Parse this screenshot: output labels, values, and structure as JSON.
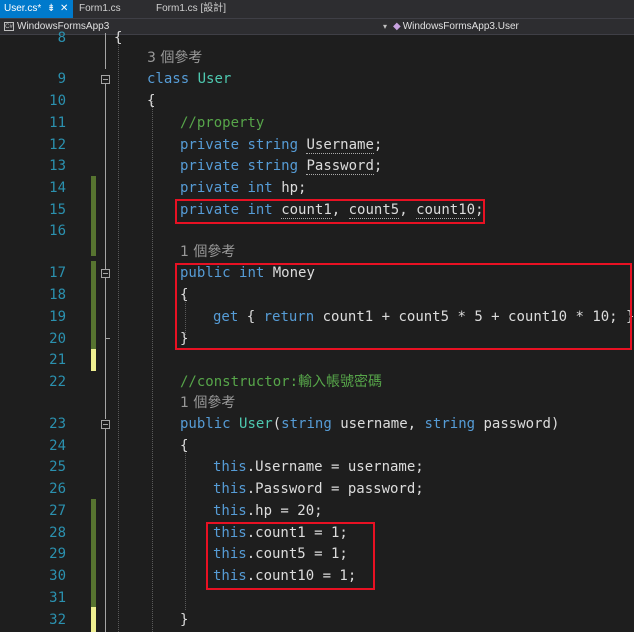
{
  "tabs": [
    {
      "name": "User.cs*",
      "pin": "⇟",
      "close": "✕"
    },
    {
      "name": "Form1.cs"
    },
    {
      "name": "Form1.cs [設計]"
    }
  ],
  "navbar": {
    "project_icon": "C#",
    "project": "WindowsFormsApp3",
    "member": "WindowsFormsApp3.User"
  },
  "editor": {
    "line_numbers": [
      "8",
      "9",
      "10",
      "11",
      "12",
      "13",
      "14",
      "15",
      "16",
      "17",
      "18",
      "19",
      "20",
      "21",
      "22",
      "23",
      "24",
      "25",
      "26",
      "27",
      "28",
      "29",
      "30",
      "31",
      "32"
    ],
    "lens_refs": {
      "class": "3 個參考",
      "money": "1 個參考",
      "ctor": "1 個參考"
    },
    "code": {
      "open_brace_8": "{",
      "kw_class": "class",
      "type_user": "User",
      "brace_open": "{",
      "comment_property": "//property",
      "kw_private": "private",
      "kw_string": "string",
      "kw_int": "int",
      "username_field": "Username",
      "password_field": "Password",
      "hp_field": "hp",
      "count1": "count1",
      "count5": "count5",
      "count10": "count10",
      "kw_public": "public",
      "money": "Money",
      "kw_get": "get",
      "kw_return": "return",
      "get_open": " { ",
      "get_expr": " count1 + count5 * 5 + count10 * 10; }",
      "brace_close": "}",
      "comment_ctor": "//constructor:輸入帳號密碼",
      "ctor_type": "User",
      "param_username": "username",
      "param_password": "password",
      "kw_this": "this",
      "assign_username": ".Username = username;",
      "assign_password": ".Password = password;",
      "assign_hp": ".hp = 20;",
      "assign_count1": ".count1 = 1;",
      "assign_count5": ".count5 = 1;",
      "assign_count10": ".count10 = 1;"
    }
  }
}
